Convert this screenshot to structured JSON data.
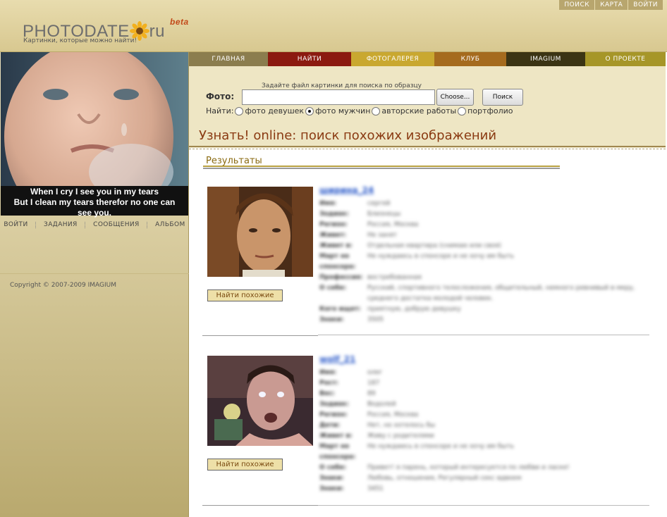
{
  "header": {
    "logo_main": "PHOTODATE",
    "logo_suffix": "ru",
    "logo_beta": "beta",
    "tagline": "Картинки, которые можно найти!",
    "top_links": [
      "ПОИСК",
      "КАРТА",
      "ВОЙТИ"
    ]
  },
  "main_nav": [
    {
      "label": "ГЛАВНАЯ",
      "color": "#8b7d4e"
    },
    {
      "label": "НАЙТИ",
      "color": "#8b1a10"
    },
    {
      "label": "ФОТОГАЛЕРЕЯ",
      "color": "#c9a830"
    },
    {
      "label": "КЛУБ",
      "color": "#a56b1e"
    },
    {
      "label": "IMAGIUM",
      "color": "#3b3414"
    },
    {
      "label": "О ПРОЕКТЕ",
      "color": "#a69628"
    }
  ],
  "left": {
    "caption_lines": [
      "When I cry I see you in my tears",
      "But I clean my tears therefor no one can",
      "see you."
    ],
    "nav": [
      "ВОЙТИ",
      "ЗАДАНИЯ",
      "СООБЩЕНИЯ",
      "АЛЬБОМ"
    ],
    "copyright": "Copyright © 2007-2009 IMAGIUM"
  },
  "search": {
    "hint": "Задайте файл картинки для поиска по образцу",
    "foto_label": "Фото:",
    "choose_label": "Choose...",
    "search_label": "Поиск",
    "find_label": "Найти:",
    "options": [
      {
        "label": "фото девушек",
        "selected": false
      },
      {
        "label": "фото мужчин",
        "selected": true
      },
      {
        "label": "авторские работы",
        "selected": false
      },
      {
        "label": "портфолио",
        "selected": false
      }
    ]
  },
  "page_title": "Узнать! online: поиск похожих изображений",
  "results": {
    "heading": "Результаты",
    "find_similar_label": "Найти похожие",
    "items": [
      {
        "nick": "ширина_24",
        "fields": [
          {
            "k": "Имя:",
            "v": "сергей"
          },
          {
            "k": "Зодиак:",
            "v": "Близнецы"
          },
          {
            "k": "Регион:",
            "v": "Россия, Москва"
          },
          {
            "k": "Живет:",
            "v": "Не занят"
          },
          {
            "k": "Живет в:",
            "v": "Отдельная квартира (снимаю или своя)"
          },
          {
            "k": "Март но спонсора:",
            "v": "Не нуждаюсь в спонсоре и не хочу им быть"
          },
          {
            "k": "Профессия:",
            "v": "востребованная"
          },
          {
            "k": "О себе:",
            "v": "Русский, спортивного телосложения, общительный, немного ревнивый в меру, среднего достатка молодой человек."
          },
          {
            "k": "Кого ищет:",
            "v": "приятную, добрую девушку"
          },
          {
            "k": "Знаки:",
            "v": "3505"
          }
        ]
      },
      {
        "nick": "wolf_21",
        "fields": [
          {
            "k": "Имя:",
            "v": "олег"
          },
          {
            "k": "Рост:",
            "v": "187"
          },
          {
            "k": "Вес:",
            "v": "89"
          },
          {
            "k": "Зодиак:",
            "v": "Водолей"
          },
          {
            "k": "Регион:",
            "v": "Россия, Москва"
          },
          {
            "k": "Дети:",
            "v": "Нет, но хотелось бы"
          },
          {
            "k": "Живет в:",
            "v": "Живу с родителями"
          },
          {
            "k": "Март но спонсора:",
            "v": "Не нуждаюсь в спонсоре и не хочу им быть"
          },
          {
            "k": "О себе:",
            "v": "Привет! я парень, который интересуется по любви и ласке!"
          },
          {
            "k": "Знаки:",
            "v": "Любовь, отношения, Регулярный секс вдвоем"
          },
          {
            "k": "Знаки:",
            "v": "3451"
          }
        ]
      }
    ]
  }
}
